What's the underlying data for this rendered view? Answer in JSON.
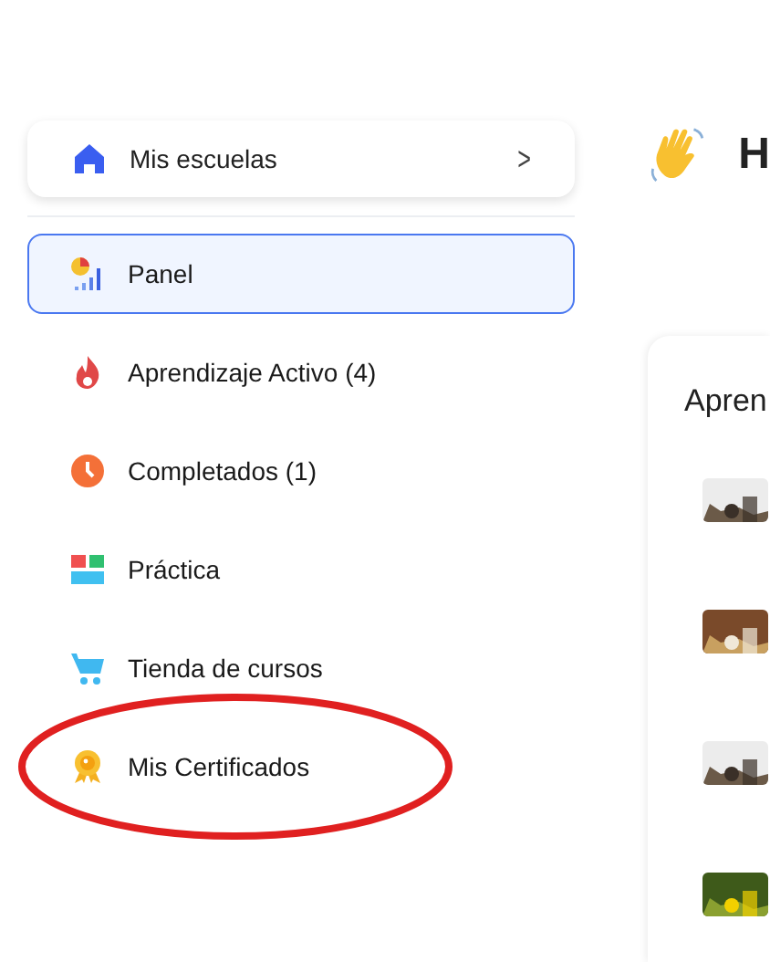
{
  "school_switcher": {
    "label": "Mis escuelas",
    "chevron": ">"
  },
  "nav": [
    {
      "label": "Panel",
      "selected": true,
      "circled": false
    },
    {
      "label": "Aprendizaje Activo (4)",
      "selected": false,
      "circled": false
    },
    {
      "label": "Completados (1)",
      "selected": false,
      "circled": false
    },
    {
      "label": "Práctica",
      "selected": false,
      "circled": false
    },
    {
      "label": "Tienda de cursos",
      "selected": false,
      "circled": false
    },
    {
      "label": "Mis Certificados",
      "selected": false,
      "circled": true
    }
  ],
  "greeting": "H",
  "course_panel": {
    "title": "Apren"
  }
}
